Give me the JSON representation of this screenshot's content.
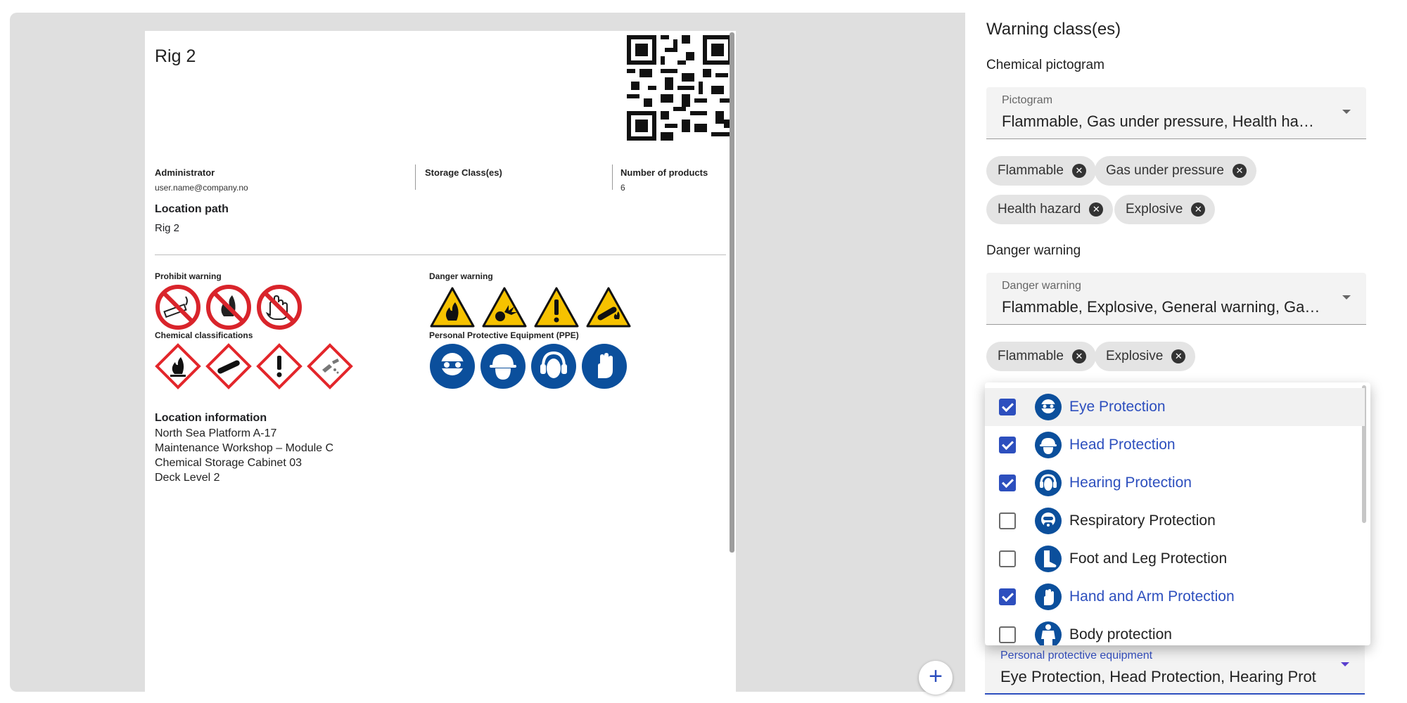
{
  "document": {
    "title": "Rig 2",
    "administrator_label": "Administrator",
    "administrator_value": "user.name@company.no",
    "storage_label": "Storage Class(es)",
    "products_label": "Number of products",
    "products_value": "6",
    "location_path_label": "Location path",
    "location_path_value": "Rig 2",
    "prohibit_label": "Prohibit warning",
    "danger_label": "Danger warning",
    "chemical_label": "Chemical classifications",
    "ppe_label": "Personal Protective Equipment (PPE)",
    "location_info_title": "Location information",
    "location_info": [
      "North Sea Platform A-17",
      "Maintenance Workshop – Module C",
      "Chemical Storage Cabinet 03",
      "Deck Level 2"
    ]
  },
  "panel": {
    "heading": "Warning class(es)",
    "chemical_pictogram_heading": "Chemical pictogram",
    "pictogram_select": {
      "label": "Pictogram",
      "value": "Flammable, Gas under pressure, Health ha…"
    },
    "pictogram_chips": [
      "Flammable",
      "Gas under pressure",
      "Health hazard",
      "Explosive"
    ],
    "danger_heading": "Danger warning",
    "danger_select": {
      "label": "Danger warning",
      "value": "Flammable, Explosive, General warning, Ga…"
    },
    "danger_chips": [
      "Flammable",
      "Explosive"
    ],
    "ppe_select": {
      "label": "Personal protective equipment",
      "value": "Eye Protection, Head Protection, Hearing Prot"
    }
  },
  "ppe_options": [
    {
      "label": "Eye Protection",
      "checked": true,
      "icon": "eye-protection-icon"
    },
    {
      "label": "Head Protection",
      "checked": true,
      "icon": "head-protection-icon"
    },
    {
      "label": "Hearing Protection",
      "checked": true,
      "icon": "hearing-protection-icon"
    },
    {
      "label": "Respiratory Protection",
      "checked": false,
      "icon": "respiratory-protection-icon"
    },
    {
      "label": "Foot and Leg Protection",
      "checked": false,
      "icon": "foot-protection-icon"
    },
    {
      "label": "Hand and Arm Protection",
      "checked": true,
      "icon": "hand-protection-icon"
    },
    {
      "label": "Body protection",
      "checked": false,
      "icon": "body-protection-icon"
    }
  ],
  "colors": {
    "accent": "#2d4fbe",
    "ppe_blue": "#0b4f9c",
    "warning_yellow": "#f6c200",
    "prohibit_red": "#d9242b",
    "ghs_red": "#e3262b"
  },
  "fab": {
    "label": "+"
  }
}
